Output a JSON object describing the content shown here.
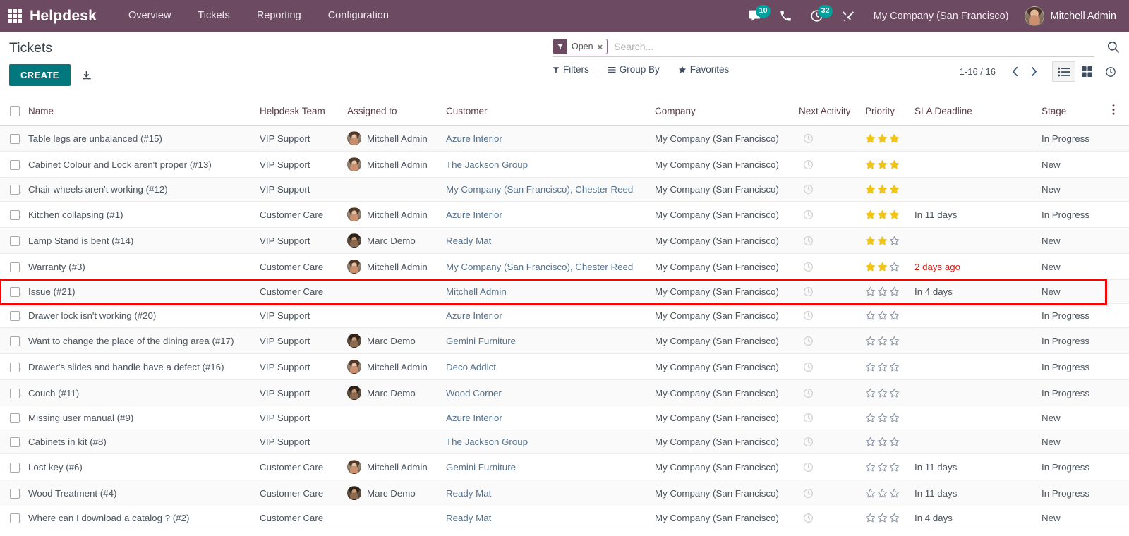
{
  "navbar": {
    "apps_icon": "apps-grid-icon",
    "brand": "Helpdesk",
    "menu": [
      {
        "label": "Overview"
      },
      {
        "label": "Tickets"
      },
      {
        "label": "Reporting"
      },
      {
        "label": "Configuration"
      }
    ],
    "messages_icon": "chat-bubble-icon",
    "messages_count": "10",
    "voip_icon": "phone-icon",
    "activities_icon": "clock-activity-icon",
    "activities_count": "32",
    "debug_icon": "wrench-tools-icon",
    "company": "My Company (San Francisco)",
    "user_avatar": "user-avatar",
    "user": "Mitchell Admin"
  },
  "control_panel": {
    "title": "Tickets",
    "create_label": "CREATE",
    "import_icon": "import-download-icon",
    "search": {
      "facet_icon": "filter-funnel-icon",
      "facet_label": "Open",
      "facet_close": "×",
      "placeholder": "Search...",
      "value": "",
      "search_icon": "search-icon"
    },
    "filters": [
      {
        "icon": "filter-funnel-icon",
        "label": "Filters"
      },
      {
        "icon": "group-by-lines-icon",
        "label": "Group By"
      },
      {
        "icon": "star-icon",
        "label": "Favorites"
      }
    ],
    "pager": "1-16 / 16",
    "prev_icon": "chevron-left-icon",
    "next_icon": "chevron-right-icon",
    "views": [
      {
        "name": "list",
        "icon": "list-view-icon",
        "active": true
      },
      {
        "name": "kanban",
        "icon": "kanban-view-icon",
        "active": false
      },
      {
        "name": "activity",
        "icon": "activity-clock-view-icon",
        "active": false
      }
    ]
  },
  "table": {
    "columns": [
      "Name",
      "Helpdesk Team",
      "Assigned to",
      "Customer",
      "Company",
      "Next Activity",
      "Priority",
      "SLA Deadline",
      "Stage"
    ],
    "options_icon": "vertical-dots-icon",
    "rows": [
      {
        "name": "Table legs are unbalanced (#15)",
        "team": "VIP Support",
        "assignee": "Mitchell Admin",
        "avatar": "mitchell",
        "customer": "Azure Interior",
        "company": "My Company (San Francisco)",
        "activity": "clock-icon",
        "priority": 3,
        "sla": "",
        "sla_late": false,
        "stage": "In Progress"
      },
      {
        "name": "Cabinet Colour and Lock aren't proper (#13)",
        "team": "VIP Support",
        "assignee": "Mitchell Admin",
        "avatar": "mitchell",
        "customer": "The Jackson Group",
        "company": "My Company (San Francisco)",
        "activity": "clock-icon",
        "priority": 3,
        "sla": "",
        "sla_late": false,
        "stage": "New"
      },
      {
        "name": "Chair wheels aren't working (#12)",
        "team": "VIP Support",
        "assignee": "",
        "avatar": "",
        "customer": "My Company (San Francisco), Chester Reed",
        "company": "My Company (San Francisco)",
        "activity": "clock-icon",
        "priority": 3,
        "sla": "",
        "sla_late": false,
        "stage": "New"
      },
      {
        "name": "Kitchen collapsing (#1)",
        "team": "Customer Care",
        "assignee": "Mitchell Admin",
        "avatar": "mitchell",
        "customer": "Azure Interior",
        "company": "My Company (San Francisco)",
        "activity": "clock-icon",
        "priority": 3,
        "sla": "In 11 days",
        "sla_late": false,
        "stage": "In Progress"
      },
      {
        "name": "Lamp Stand is bent (#14)",
        "team": "VIP Support",
        "assignee": "Marc Demo",
        "avatar": "marc",
        "customer": "Ready Mat",
        "company": "My Company (San Francisco)",
        "activity": "clock-icon",
        "priority": 2,
        "sla": "",
        "sla_late": false,
        "stage": "New"
      },
      {
        "name": "Warranty (#3)",
        "team": "Customer Care",
        "assignee": "Mitchell Admin",
        "avatar": "mitchell",
        "customer": "My Company (San Francisco), Chester Reed",
        "company": "My Company (San Francisco)",
        "activity": "clock-icon",
        "priority": 2,
        "sla": "2 days ago",
        "sla_late": true,
        "stage": "New"
      },
      {
        "name": "Issue (#21)",
        "team": "Customer Care",
        "assignee": "",
        "avatar": "",
        "customer": "Mitchell Admin",
        "company": "My Company (San Francisco)",
        "activity": "clock-icon",
        "priority": 0,
        "sla": "In 4 days",
        "sla_late": false,
        "stage": "New",
        "highlighted": true
      },
      {
        "name": "Drawer lock isn't working (#20)",
        "team": "VIP Support",
        "assignee": "",
        "avatar": "",
        "customer": "Azure Interior",
        "company": "My Company (San Francisco)",
        "activity": "clock-icon",
        "priority": 0,
        "sla": "",
        "sla_late": false,
        "stage": "In Progress"
      },
      {
        "name": "Want to change the place of the dining area (#17)",
        "team": "VIP Support",
        "assignee": "Marc Demo",
        "avatar": "marc",
        "customer": "Gemini Furniture",
        "company": "My Company (San Francisco)",
        "activity": "clock-icon",
        "priority": 0,
        "sla": "",
        "sla_late": false,
        "stage": "In Progress"
      },
      {
        "name": "Drawer's slides and handle have a defect (#16)",
        "team": "VIP Support",
        "assignee": "Mitchell Admin",
        "avatar": "mitchell",
        "customer": "Deco Addict",
        "company": "My Company (San Francisco)",
        "activity": "clock-icon",
        "priority": 0,
        "sla": "",
        "sla_late": false,
        "stage": "In Progress"
      },
      {
        "name": "Couch (#11)",
        "team": "VIP Support",
        "assignee": "Marc Demo",
        "avatar": "marc",
        "customer": "Wood Corner",
        "company": "My Company (San Francisco)",
        "activity": "clock-icon",
        "priority": 0,
        "sla": "",
        "sla_late": false,
        "stage": "In Progress"
      },
      {
        "name": "Missing user manual (#9)",
        "team": "VIP Support",
        "assignee": "",
        "avatar": "",
        "customer": "Azure Interior",
        "company": "My Company (San Francisco)",
        "activity": "clock-icon",
        "priority": 0,
        "sla": "",
        "sla_late": false,
        "stage": "New"
      },
      {
        "name": "Cabinets in kit (#8)",
        "team": "VIP Support",
        "assignee": "",
        "avatar": "",
        "customer": "The Jackson Group",
        "company": "My Company (San Francisco)",
        "activity": "clock-icon",
        "priority": 0,
        "sla": "",
        "sla_late": false,
        "stage": "New"
      },
      {
        "name": "Lost key (#6)",
        "team": "Customer Care",
        "assignee": "Mitchell Admin",
        "avatar": "mitchell",
        "customer": "Gemini Furniture",
        "company": "My Company (San Francisco)",
        "activity": "clock-icon",
        "priority": 0,
        "sla": "In 11 days",
        "sla_late": false,
        "stage": "In Progress"
      },
      {
        "name": "Wood Treatment (#4)",
        "team": "Customer Care",
        "assignee": "Marc Demo",
        "avatar": "marc",
        "customer": "Ready Mat",
        "company": "My Company (San Francisco)",
        "activity": "clock-icon",
        "priority": 0,
        "sla": "In 11 days",
        "sla_late": false,
        "stage": "In Progress"
      },
      {
        "name": "Where can I download a catalog ? (#2)",
        "team": "Customer Care",
        "assignee": "",
        "avatar": "",
        "customer": "Ready Mat",
        "company": "My Company (San Francisco)",
        "activity": "clock-icon",
        "priority": 0,
        "sla": "In 4 days",
        "sla_late": false,
        "stage": "New"
      }
    ]
  },
  "colors": {
    "navbar": "#6b4a62",
    "accent_teal": "#00787d",
    "badge_teal": "#00a09d",
    "star_gold": "#f0c419",
    "highlight_red": "#ff0000",
    "late_red": "#d9211a",
    "link_blue": "#54728e"
  }
}
